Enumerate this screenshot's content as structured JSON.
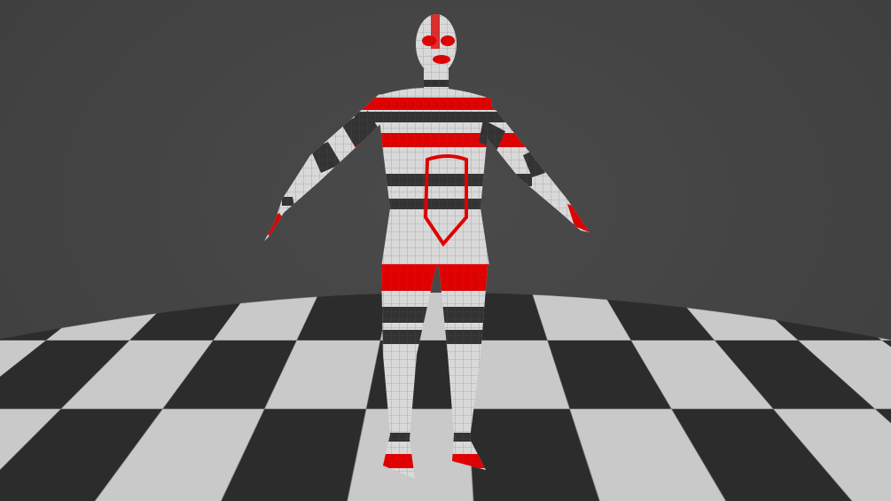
{
  "scene": {
    "background_color": "#434343",
    "floor_light_color": "#c9c9c9",
    "floor_dark_color": "#2c2c2c",
    "figure_base_color": "#d9d9d9",
    "figure_red_color": "#e00000",
    "figure_dark_color": "#333333"
  }
}
